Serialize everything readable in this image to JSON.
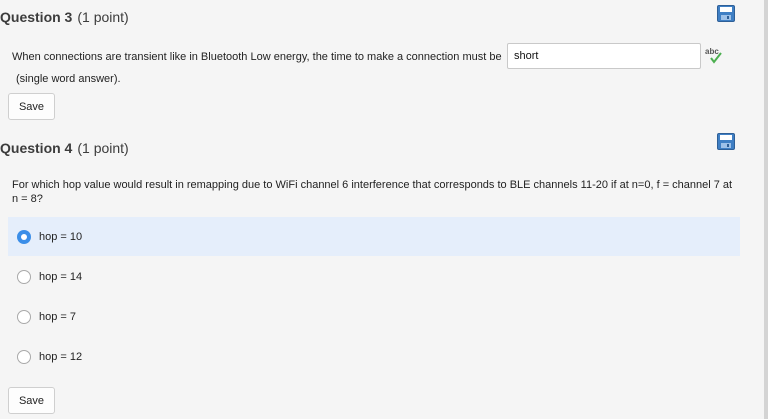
{
  "q3": {
    "title": "Question 3",
    "points": "(1 point)",
    "prompt": "When connections are transient like in Bluetooth Low energy, the time to make a connection must be",
    "answer_value": "short",
    "hint": "(single word answer).",
    "save_label": "Save",
    "spellcheck_text": "abc"
  },
  "q4": {
    "title": "Question 4",
    "points": "(1 point)",
    "prompt": "For which hop value would result in remapping due to WiFi channel 6 interference that corresponds to BLE channels 11-20 if at n=0, f = channel 7 at n = 8?",
    "options": [
      {
        "label": "hop = 10",
        "selected": true
      },
      {
        "label": "hop = 14",
        "selected": false
      },
      {
        "label": "hop = 7",
        "selected": false
      },
      {
        "label": "hop = 12",
        "selected": false
      }
    ],
    "save_label": "Save"
  },
  "colors": {
    "selected_background": "#e5eefb",
    "radio_accent": "#3b8ee8",
    "save_icon": "#3f7fc4"
  },
  "icons": {
    "save": "save-icon",
    "spellcheck": "spellcheck-icon"
  }
}
